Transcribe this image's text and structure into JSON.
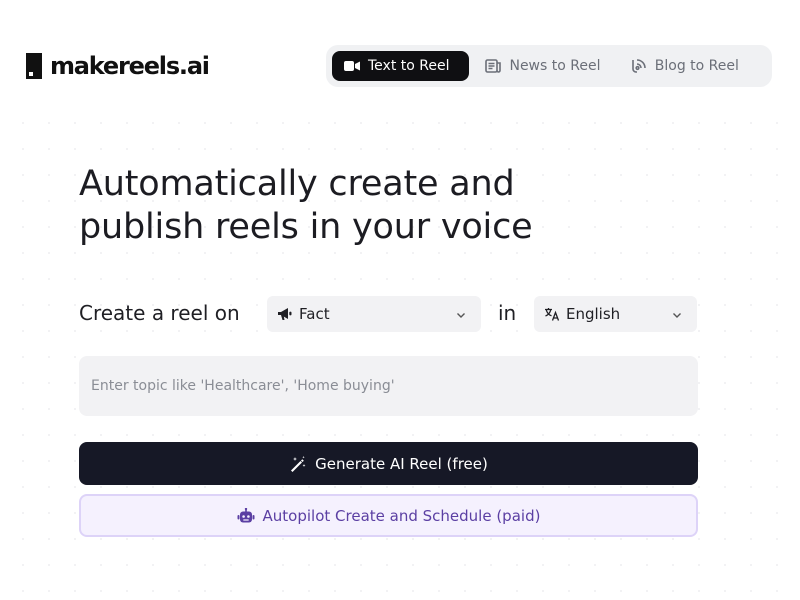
{
  "brand": {
    "name": "makereels.ai"
  },
  "nav": {
    "tabs": [
      {
        "label": "Text to Reel",
        "icon": "video-camera-icon",
        "active": true
      },
      {
        "label": "News to Reel",
        "icon": "newspaper-icon",
        "active": false
      },
      {
        "label": "Blog to Reel",
        "icon": "blog-icon",
        "active": false
      }
    ]
  },
  "hero": {
    "line1": "Automatically create and",
    "line2": "publish reels in your voice"
  },
  "form": {
    "create_label": "Create a reel on",
    "type_value": "Fact",
    "in_label": "in",
    "language_value": "English",
    "topic_placeholder": "Enter topic like 'Healthcare', 'Home buying'",
    "topic_value": ""
  },
  "actions": {
    "generate_label": "Generate AI Reel (free)",
    "autopilot_label": "Autopilot Create and Schedule (paid)"
  },
  "colors": {
    "primary_dark": "#161826",
    "autopilot_text": "#5b3fa3",
    "autopilot_bg": "#f5f1fe",
    "autopilot_border": "#ddd3f8",
    "field_bg": "#f2f2f4"
  }
}
